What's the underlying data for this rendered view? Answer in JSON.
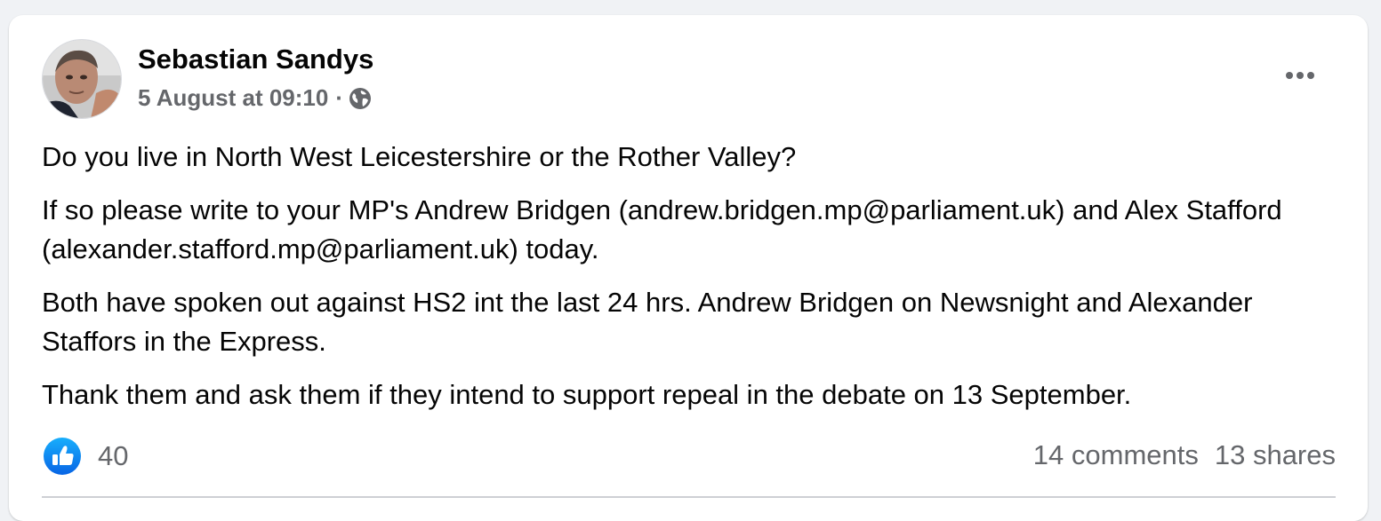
{
  "post": {
    "author": "Sebastian Sandys",
    "timestamp": "5 August at 09:10",
    "separator": "·",
    "audience_icon": "globe-icon",
    "menu_icon": "more-horizontal-icon",
    "paragraphs": [
      "Do you live in North West Leicestershire or the Rother Valley?",
      "If so please write to your MP's Andrew Bridgen (andrew.bridgen.mp@parliament.uk) and Alex Stafford (alexander.stafford.mp@parliament.uk) today.",
      "Both have spoken out against HS2 int the last 24 hrs. Andrew Bridgen on Newsnight and Alexander Staffors in the Express.",
      "Thank them and ask them if they intend to support repeal in the debate on 13 September."
    ]
  },
  "engagement": {
    "reaction_icon": "like-icon",
    "reaction_count": "40",
    "comments": "14 comments",
    "shares": "13 shares"
  },
  "colors": {
    "background": "#f0f2f5",
    "card": "#ffffff",
    "secondary_text": "#65676b",
    "like_blue": "#1877f2"
  }
}
